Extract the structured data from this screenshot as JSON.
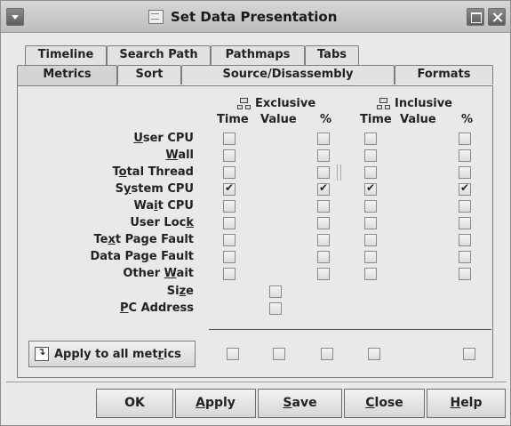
{
  "window": {
    "title": "Set Data Presentation"
  },
  "tabs_row1": [
    {
      "label": "Timeline"
    },
    {
      "label": "Search Path"
    },
    {
      "label": "Pathmaps"
    },
    {
      "label": "Tabs"
    }
  ],
  "tabs_row2": [
    {
      "label": "Metrics",
      "active": true
    },
    {
      "label": "Sort"
    },
    {
      "label": "Source/Disassembly"
    },
    {
      "label": "Formats"
    }
  ],
  "groups": {
    "exclusive": {
      "label": "Exclusive",
      "icon": "exclusive-tree-icon"
    },
    "inclusive": {
      "label": "Inclusive",
      "icon": "inclusive-tree-icon"
    }
  },
  "columns": {
    "excl_time": "Time",
    "excl_value": "Value",
    "excl_pct": "%",
    "incl_time": "Time",
    "incl_value": "Value",
    "incl_pct": "%"
  },
  "metrics": [
    {
      "label_pre": "",
      "label_u": "U",
      "label_post": "ser CPU",
      "excl_time": false,
      "excl_pct": false,
      "incl_time": false,
      "incl_pct": false
    },
    {
      "label_pre": "",
      "label_u": "W",
      "label_post": "all",
      "excl_time": false,
      "excl_pct": false,
      "incl_time": false,
      "incl_pct": false
    },
    {
      "label_pre": "T",
      "label_u": "o",
      "label_post": "tal Thread",
      "excl_time": false,
      "excl_pct": false,
      "incl_time": false,
      "incl_pct": false
    },
    {
      "label_pre": "S",
      "label_u": "y",
      "label_post": "stem CPU",
      "excl_time": true,
      "excl_pct": true,
      "incl_time": true,
      "incl_pct": true
    },
    {
      "label_pre": "Wa",
      "label_u": "i",
      "label_post": "t CPU",
      "excl_time": false,
      "excl_pct": false,
      "incl_time": false,
      "incl_pct": false
    },
    {
      "label_pre": "User Loc",
      "label_u": "k",
      "label_post": "",
      "excl_time": false,
      "excl_pct": false,
      "incl_time": false,
      "incl_pct": false
    },
    {
      "label_pre": "Te",
      "label_u": "x",
      "label_post": "t Page Fault",
      "excl_time": false,
      "excl_pct": false,
      "incl_time": false,
      "incl_pct": false
    },
    {
      "label_pre": "Data Pa",
      "label_u": "g",
      "label_post": "e Fault",
      "excl_time": false,
      "excl_pct": false,
      "incl_time": false,
      "incl_pct": false
    },
    {
      "label_pre": "Other ",
      "label_u": "W",
      "label_post": "ait",
      "excl_time": false,
      "excl_pct": false,
      "incl_time": false,
      "incl_pct": false
    }
  ],
  "extra_metrics": [
    {
      "label_pre": "Si",
      "label_u": "z",
      "label_post": "e",
      "value": false
    },
    {
      "label_pre": "",
      "label_u": "P",
      "label_post": "C Address",
      "value": false
    }
  ],
  "apply_all": {
    "label_pre": "Apply to all met",
    "label_u": "r",
    "label_post": "ics"
  },
  "buttons": {
    "ok": {
      "pre": "OK",
      "u": "",
      "post": ""
    },
    "apply": {
      "pre": "",
      "u": "A",
      "post": "pply"
    },
    "save": {
      "pre": "",
      "u": "S",
      "post": "ave"
    },
    "close": {
      "pre": "",
      "u": "C",
      "post": "lose"
    },
    "help": {
      "pre": "",
      "u": "H",
      "post": "elp"
    }
  }
}
